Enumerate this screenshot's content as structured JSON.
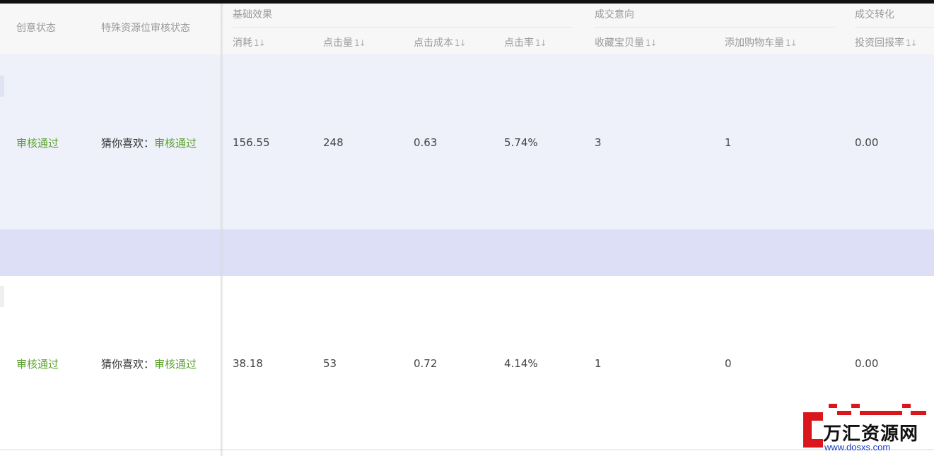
{
  "header": {
    "columns": {
      "creative_status": "创意状态",
      "special_status": "特殊资源位审核状态",
      "cost": "消耗",
      "clicks": "点击量",
      "cpc": "点击成本",
      "ctr": "点击率",
      "favorites": "收藏宝贝量",
      "cart_adds": "添加购物车量",
      "roi": "投资回报率"
    },
    "groups": {
      "basic": "基础效果",
      "intent": "成交意向",
      "conversion": "成交转化"
    },
    "sort_glyph": "1↓"
  },
  "rows": [
    {
      "creative_status": "审核通过",
      "special_prefix": "猜你喜欢：",
      "special_status": "审核通过",
      "cost": "156.55",
      "clicks": "248",
      "cpc": "0.63",
      "ctr": "5.74%",
      "favorites": "3",
      "cart_adds": "1",
      "roi": "0.00"
    },
    {
      "creative_status": "审核通过",
      "special_prefix": "猜你喜欢：",
      "special_status": "审核通过",
      "cost": "38.18",
      "clicks": "53",
      "cpc": "0.72",
      "ctr": "4.14%",
      "favorites": "1",
      "cart_adds": "0",
      "roi": "0.00"
    }
  ],
  "watermark": {
    "name": "万汇资源网",
    "url": "www.dosxs.com"
  },
  "colors": {
    "status_green": "#5aa12d",
    "watermark_red": "#d9161c",
    "watermark_url": "#1a3ec4",
    "selected_row": "#eef0fa",
    "separator_row": "#dcdff5"
  }
}
